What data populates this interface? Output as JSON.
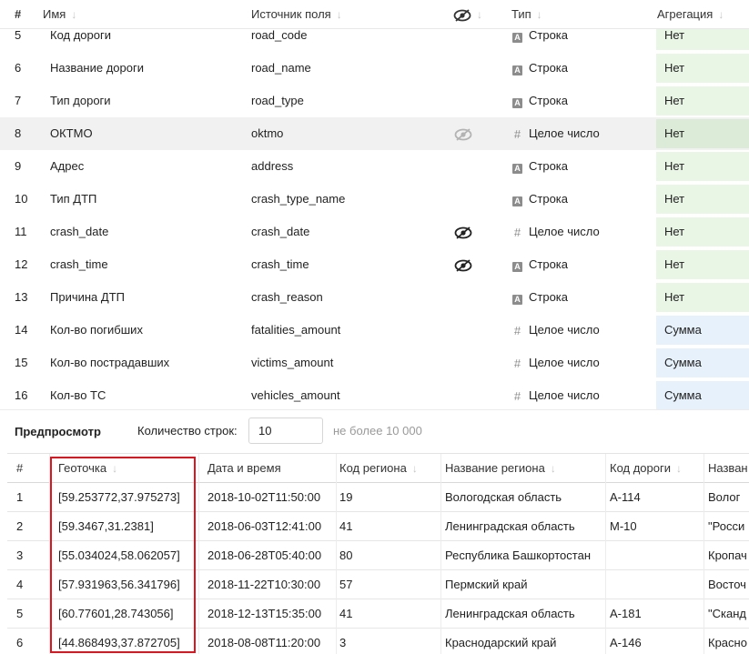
{
  "fields": {
    "headers": {
      "num": "#",
      "name": "Имя",
      "source": "Источник поля",
      "type": "Тип",
      "aggregation": "Агрегация"
    },
    "rows": [
      {
        "num": "5",
        "name": "Код дороги",
        "source": "road_code",
        "hidden": false,
        "type_icon": "string-icon",
        "type": "Строка",
        "agg": "Нет",
        "agg_kind": "none"
      },
      {
        "num": "6",
        "name": "Название дороги",
        "source": "road_name",
        "hidden": false,
        "type_icon": "string-icon",
        "type": "Строка",
        "agg": "Нет",
        "agg_kind": "none"
      },
      {
        "num": "7",
        "name": "Тип дороги",
        "source": "road_type",
        "hidden": false,
        "type_icon": "string-icon",
        "type": "Строка",
        "agg": "Нет",
        "agg_kind": "none"
      },
      {
        "num": "8",
        "name": "ОКТМО",
        "source": "oktmo",
        "hidden": false,
        "hover": true,
        "type_icon": "integer-icon",
        "type": "Целое число",
        "agg": "Нет",
        "agg_kind": "none"
      },
      {
        "num": "9",
        "name": "Адрес",
        "source": "address",
        "hidden": false,
        "type_icon": "string-icon",
        "type": "Строка",
        "agg": "Нет",
        "agg_kind": "none"
      },
      {
        "num": "10",
        "name": "Тип ДТП",
        "source": "crash_type_name",
        "hidden": false,
        "type_icon": "string-icon",
        "type": "Строка",
        "agg": "Нет",
        "agg_kind": "none"
      },
      {
        "num": "11",
        "name": "crash_date",
        "source": "crash_date",
        "hidden": true,
        "type_icon": "integer-icon",
        "type": "Целое число",
        "agg": "Нет",
        "agg_kind": "none"
      },
      {
        "num": "12",
        "name": "crash_time",
        "source": "crash_time",
        "hidden": true,
        "type_icon": "string-icon",
        "type": "Строка",
        "agg": "Нет",
        "agg_kind": "none"
      },
      {
        "num": "13",
        "name": "Причина ДТП",
        "source": "crash_reason",
        "hidden": false,
        "type_icon": "string-icon",
        "type": "Строка",
        "agg": "Нет",
        "agg_kind": "none"
      },
      {
        "num": "14",
        "name": "Кол-во погибших",
        "source": "fatalities_amount",
        "hidden": false,
        "type_icon": "integer-icon",
        "type": "Целое число",
        "agg": "Сумма",
        "agg_kind": "sum"
      },
      {
        "num": "15",
        "name": "Кол-во пострадавших",
        "source": "victims_amount",
        "hidden": false,
        "type_icon": "integer-icon",
        "type": "Целое число",
        "agg": "Сумма",
        "agg_kind": "sum"
      },
      {
        "num": "16",
        "name": "Кол-во ТС",
        "source": "vehicles_amount",
        "hidden": false,
        "type_icon": "integer-icon",
        "type": "Целое число",
        "agg": "Сумма",
        "agg_kind": "sum"
      }
    ]
  },
  "preview_bar": {
    "title": "Предпросмотр",
    "rows_label": "Количество строк:",
    "rows_value": "10",
    "rows_hint": "не более 10 000"
  },
  "preview": {
    "headers": [
      "#",
      "Геоточка",
      "Дата и время",
      "Код региона",
      "Название региона",
      "Код дороги",
      "Назван"
    ],
    "sortable": [
      false,
      true,
      false,
      true,
      true,
      true,
      false
    ],
    "rows": [
      [
        "1",
        "[59.253772,37.975273]",
        "2018-10-02T11:50:00",
        "19",
        "Вологодская область",
        "А-114",
        "Волог"
      ],
      [
        "2",
        "[59.3467,31.2381]",
        "2018-06-03T12:41:00",
        "41",
        "Ленинградская область",
        "М-10",
        "\"Росси"
      ],
      [
        "3",
        "[55.034024,58.062057]",
        "2018-06-28T05:40:00",
        "80",
        "Республика Башкортостан",
        "",
        "Кропач"
      ],
      [
        "4",
        "[57.931963,56.341796]",
        "2018-11-22T10:30:00",
        "57",
        "Пермский край",
        "",
        "Восточ"
      ],
      [
        "5",
        "[60.77601,28.743056]",
        "2018-12-13T15:35:00",
        "41",
        "Ленинградская область",
        "А-181",
        "\"Сканд"
      ],
      [
        "6",
        "[44.868493,37.872705]",
        "2018-08-08T11:20:00",
        "3",
        "Краснодарский край",
        "А-146",
        "Красно"
      ]
    ]
  },
  "colors": {
    "highlight": "#e0141e",
    "agg_none_bg": "#e9f6e6",
    "agg_sum_bg": "#e6f1fb"
  }
}
